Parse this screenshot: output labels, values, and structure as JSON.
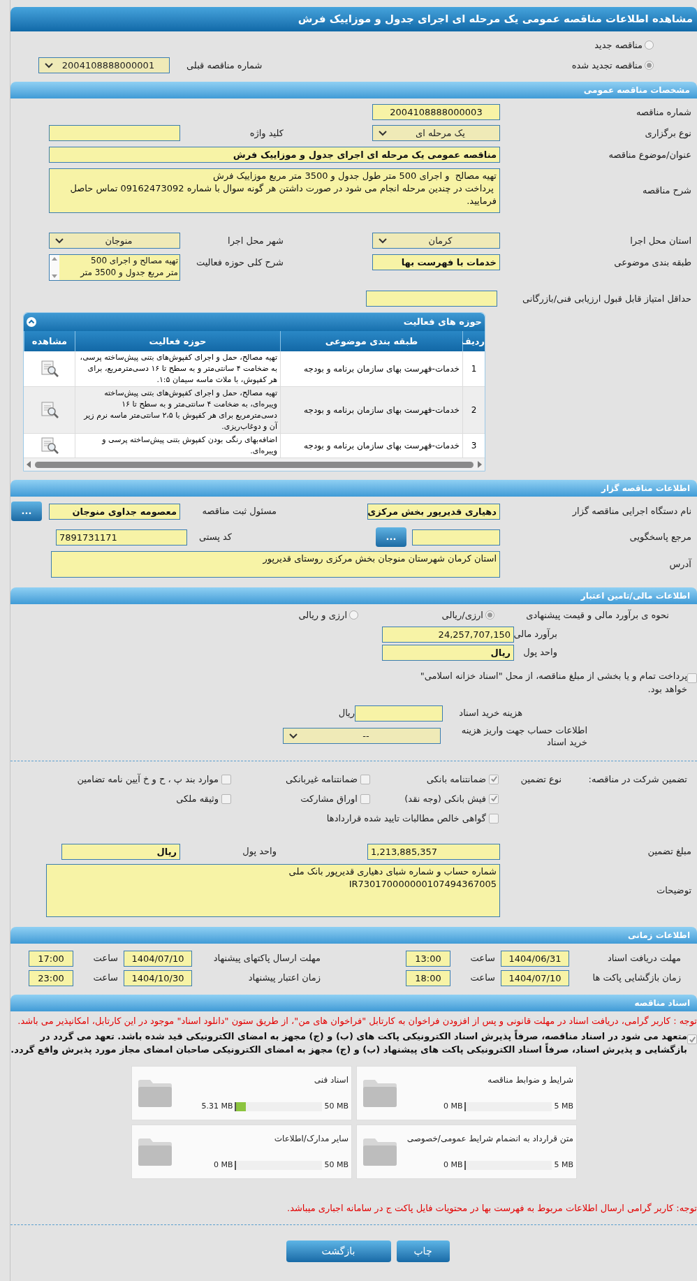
{
  "title": "مشاهده اطلاعات مناقصه عمومی یک مرحله ای اجرای جدول و موزاییک فرش",
  "tender_kind": {
    "options": [
      {
        "label": "مناقصه جدید",
        "selected": false
      },
      {
        "label": "مناقصه تجدید شده",
        "selected": true
      }
    ],
    "previous_label": "شماره مناقصه قبلی",
    "previous_value": "2004108888000001"
  },
  "general": {
    "header": "مشخصات مناقصه عمومی",
    "number_label": "شماره مناقصه",
    "number": "2004108888000003",
    "type_label": "نوع برگزاری",
    "type": "یک مرحله ای",
    "keyword_label": "کلید واژه",
    "subject_label": "عنوان/موضوع مناقصه",
    "subject": "مناقصه عمومی یک مرحله ای اجرای جدول و موزاییک فرش",
    "description_label": "شرح مناقصه",
    "description": "تهیه مصالح  و اجرای 500 متر طول جدول و 3500 متر مربع موزاییک فرش\n پرداخت در چندین مرحله انجام می شود در صورت داشتن هر گونه سوال با شماره 09162473092 تماس حاصل فرمایید.",
    "province_label": "استان محل اجرا",
    "province": "کرمان",
    "city_label": "شهر محل اجرا",
    "city": "منوجان",
    "category_label": "طبقه بندی موضوعی",
    "category": "خدمات با فهرست بها",
    "scope_label": "شرح کلی حوزه فعالیت",
    "scope_lines": [
      "تهیه مصالح  و اجرای 500",
      "متر مربع جدول و 3500 متر"
    ],
    "min_score_label": "حداقل امتیاز قابل قبول ارزیابی فنی/بازرگانی"
  },
  "activities": {
    "header": "حوزه های فعالیت",
    "columns": [
      "ردیف",
      "طبقه بندی موضوعی",
      "حوزه فعالیت",
      "مشاهده"
    ],
    "rows": [
      {
        "index": "1",
        "category": "خدمات-فهرست بهای سازمان برنامه و بودجه",
        "activity": "تهیه مصالح، حمل و اجرای کفپوش‌های بتنی پیش‌ساخته پرسی، به ضخامت ۴ سانتی‌متر و به سطح تا ۱۶ دسی‌مترمربع، برای هر کفپوش، با ملات ماسه سیمان ۱:۵."
      },
      {
        "index": "2",
        "category": "خدمات-فهرست بهای سازمان برنامه و بودجه",
        "activity": "تهیه مصالح، حمل و اجرای کفپوش‌های بتنی پیش‌ساخته ویبره‌ای، به ضخامت ۴ سانتی‌متر و به سطح تا ۱۶ دسی‌مترمربع برای هر کفپوش با ۲،۵ سانتی‌متر ماسه نرم زیر آن و دوغاب‌ریزی."
      },
      {
        "index": "3",
        "category": "خدمات-فهرست بهای سازمان برنامه و بودجه",
        "activity": "اضافه‌بهای رنگی بودن کفپوش بتنی پیش‌ساخته پرسی و ویبره‌ای."
      }
    ]
  },
  "organizer": {
    "header": "اطلاعات مناقصه گزار",
    "agency_label": "نام دستگاه اجرایی مناقصه گزار",
    "agency": "دهیاری قدیرپور بخش مرکزی",
    "registrar_label": "مسئول ثبت مناقصه",
    "registrar": "معصومه جداوی منوجان",
    "registrar_button": "...",
    "reference_label": "مرجع پاسخگویی",
    "reference_button": "...",
    "postal_label": "کد پستی",
    "postal": "7891731171",
    "address_label": "آدرس",
    "address": "استان کرمان شهرستان منوجان بخش مرکزی روستای قدیرپور"
  },
  "finance": {
    "header": "اطلاعات مالی/تامین اعتبار",
    "method_label": "نحوه ی برآورد مالی و قیمت پیشنهادی",
    "methods": [
      {
        "label": "ارزی/ریالی",
        "selected": true
      },
      {
        "label": "ارزی و ریالی",
        "selected": false
      }
    ],
    "estimate_label": "برآورد مالی",
    "estimate": "24,257,707,150",
    "currency_label": "واحد پول",
    "currency": "ریال",
    "treasury": {
      "label": "پرداخت تمام و یا بخشی از مبلغ مناقصه، از محل \"اسناد خزانه اسلامی\" خواهد بود.",
      "checked": false
    },
    "fee_label": "هزینه خرید اسناد",
    "fee_unit": "ریال",
    "account_label": "اطلاعات حساب جهت واریز هزینه خرید اسناد",
    "account": "--"
  },
  "guarantee": {
    "label": "تضمین شرکت در مناقصه:",
    "type_label": "نوع تضمین",
    "types": [
      {
        "label": "ضمانتنامه بانکی",
        "checked": true
      },
      {
        "label": "ضمانتنامه غیربانکی",
        "checked": false
      },
      {
        "label": "موارد بند پ ، ح و خ آیین نامه تضامین",
        "checked": false
      },
      {
        "label": "فیش بانکی (وجه نقد)",
        "checked": true
      },
      {
        "label": "اوراق مشارکت",
        "checked": false
      },
      {
        "label": "وثیقه ملکی",
        "checked": false
      },
      {
        "label": "گواهی خالص مطالبات تایید شده قراردادها",
        "checked": false
      }
    ],
    "amount_label": "مبلغ تضمین",
    "amount": "1,213,885,357",
    "currency_label": "واحد پول",
    "currency": "ریال",
    "notes_label": "توضیحات",
    "notes": "شماره حساب و شماره شبای دهیاری قدیرپور بانک ملی\nIR730170000000107494367005"
  },
  "timing": {
    "header": "اطلاعات زمانی",
    "items": [
      {
        "label": "مهلت دریافت اسناد",
        "date": "1404/06/31",
        "time_label": "ساعت",
        "time": "13:00"
      },
      {
        "label": "مهلت ارسال پاکتهای پیشنهاد",
        "date": "1404/07/10",
        "time_label": "ساعت",
        "time": "17:00"
      },
      {
        "label": "زمان بازگشایی پاکت ها",
        "date": "1404/07/10",
        "time_label": "ساعت",
        "time": "18:00"
      },
      {
        "label": "زمان اعتبار پیشنهاد",
        "date": "1404/10/30",
        "time_label": "ساعت",
        "time": "23:00"
      }
    ]
  },
  "documents": {
    "header": "اسناد مناقصه",
    "notice": "توجه : کاربر گرامی، دریافت اسناد در مهلت قانونی و پس از افزودن فراخوان به کارتابل \"فراخوان های من\"، از طریق ستون \"دانلود اسناد\" موجود در این کارتابل، امکانپذیر می باشد.",
    "pledge": {
      "text": "متعهد می شود در اسناد مناقصه، صرفاً پذیرش اسناد الکترونیکی پاکت های (ب) و (ج) مجهز به امضای الکترونیکی قید شده باشد. تعهد می گردد در بازگشایی و پذیرش اسناد، صرفاً اسناد الکترونیکی پاکت های پیشنهاد (ب) و (ج) مجهز به امضای الکترونیکی صاحبان امضای مجاز مورد پذیرش واقع گردد.",
      "checked": true
    },
    "files": [
      {
        "name": "شرایط و ضوابط مناقصه",
        "size": "0 MB",
        "max": "5 MB",
        "level": 0
      },
      {
        "name": "اسناد فنی",
        "size": "5.31 MB",
        "max": "50 MB",
        "level": 0.106
      },
      {
        "name": "متن قرارداد به انضمام شرایط عمومی/خصوصی",
        "size": "0 MB",
        "max": "5 MB",
        "level": 0
      },
      {
        "name": "سایر مدارک/اطلاعات",
        "size": "0 MB",
        "max": "50 MB",
        "level": 0
      }
    ],
    "note": "توجه: کاربر گرامی ارسال اطلاعات مربوط به فهرست بها در محتویات فایل پاکت ج در سامانه اجباری میباشد."
  },
  "buttons": [
    "چاپ",
    "بازگشت"
  ]
}
